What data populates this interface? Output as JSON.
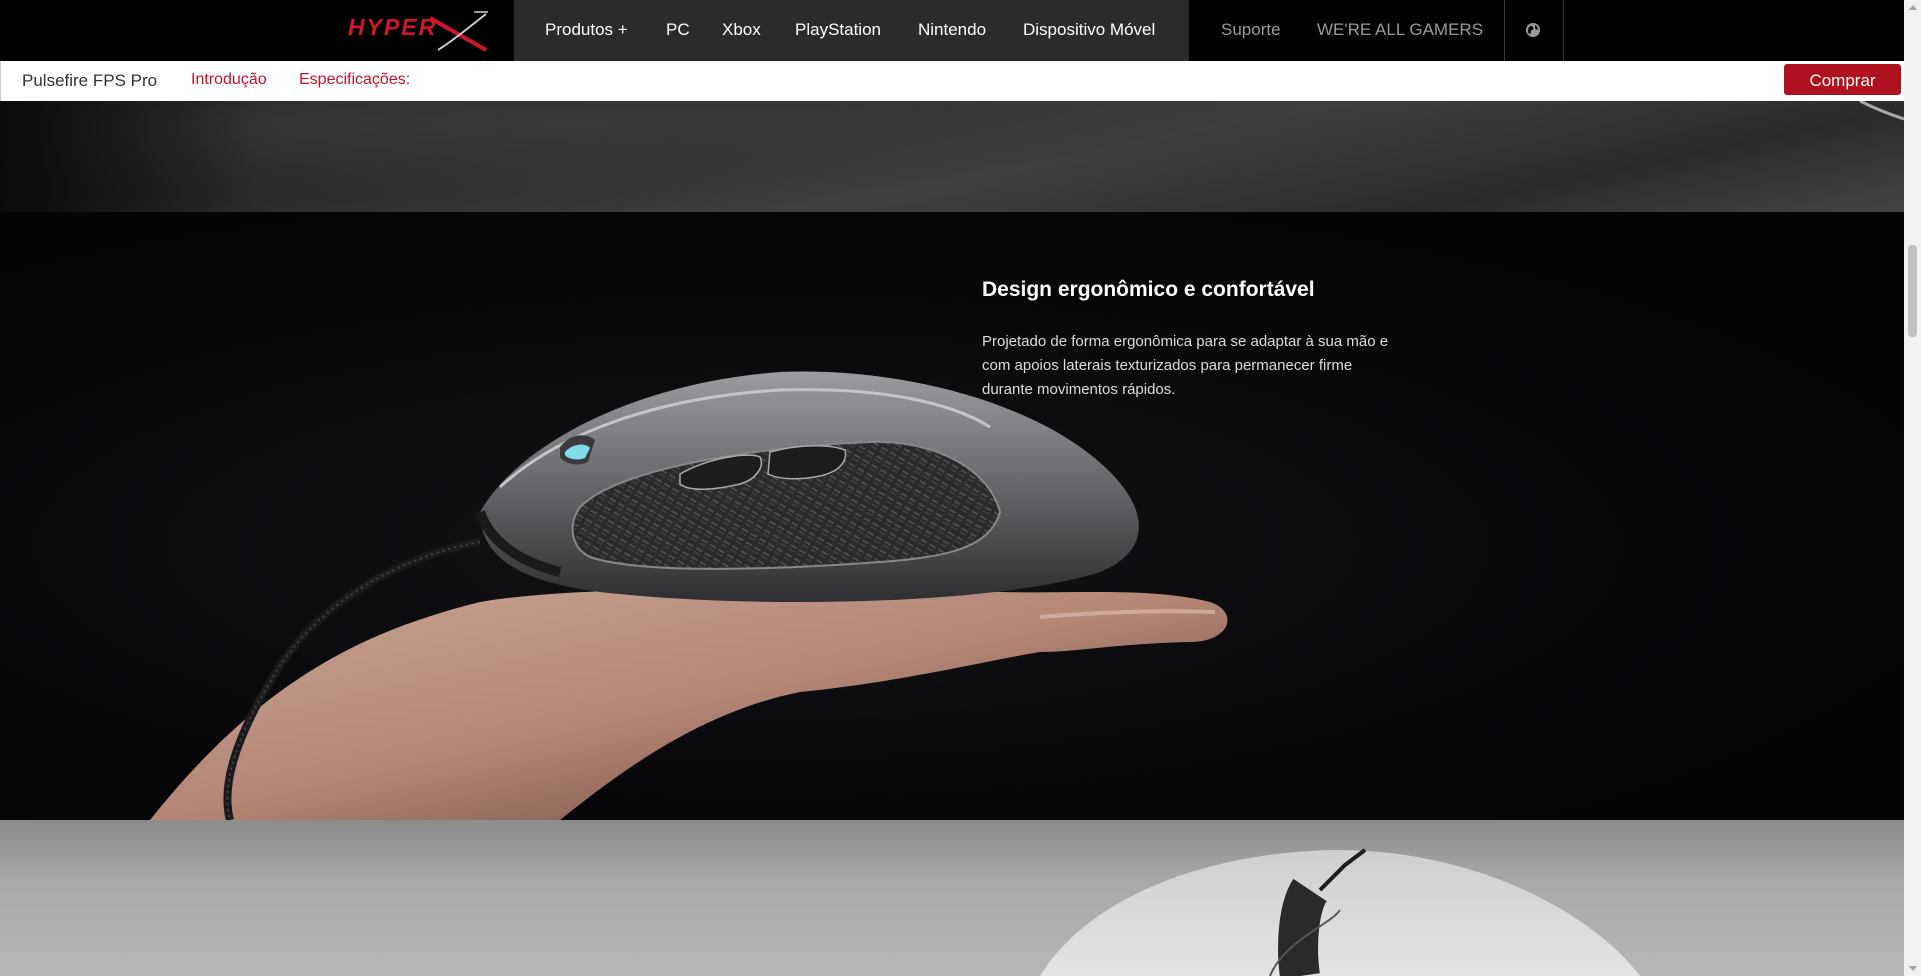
{
  "topnav": {
    "logo_text": "HYPER",
    "items": [
      {
        "label": "Produtos +"
      },
      {
        "label": "PC"
      },
      {
        "label": "Xbox"
      },
      {
        "label": "PlayStation"
      },
      {
        "label": "Nintendo"
      },
      {
        "label": "Dispositivo Móvel"
      }
    ],
    "right_items": [
      {
        "label": "Suporte"
      },
      {
        "label": "WE'RE ALL GAMERS"
      }
    ],
    "globe_icon": "globe-icon"
  },
  "subnav": {
    "product_name": "Pulsefire FPS Pro",
    "links": [
      {
        "label": "Introdução"
      },
      {
        "label": "Especificações:"
      }
    ],
    "buy_label": "Comprar"
  },
  "feature": {
    "title": "Design ergonômico e confortável",
    "description": "Projetado de forma ergonômica para se adaptar à sua mão e com apoios laterais texturizados para permanecer firme durante movimentos rápidos."
  },
  "colors": {
    "accent": "#c8102e",
    "buy_button": "#b0111f",
    "nav_block": "#2b2b2d"
  }
}
